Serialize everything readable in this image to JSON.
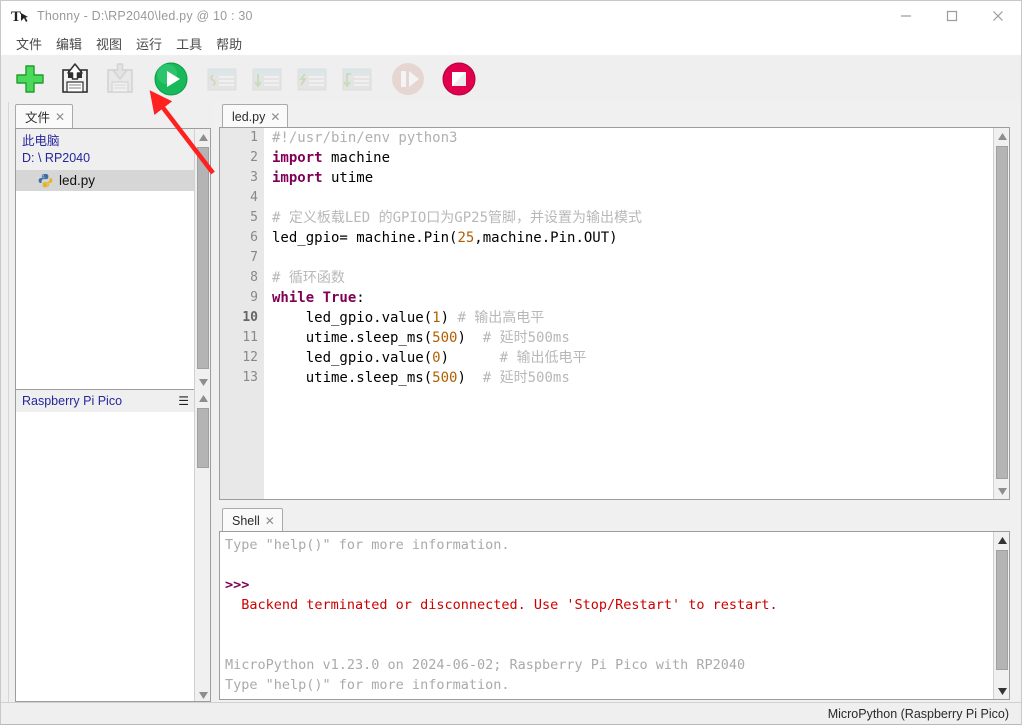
{
  "window": {
    "app_icon": "thonny-icon",
    "title": "Thonny  -  D:\\RP2040\\led.py  @  10 : 30",
    "minimize_label": "–",
    "maximize_label": "□",
    "close_label": "✕"
  },
  "menubar": {
    "items": [
      {
        "label": "文件",
        "name": "menu-file"
      },
      {
        "label": "编辑",
        "name": "menu-edit"
      },
      {
        "label": "视图",
        "name": "menu-view"
      },
      {
        "label": "运行",
        "name": "menu-run"
      },
      {
        "label": "工具",
        "name": "menu-tools"
      },
      {
        "label": "帮助",
        "name": "menu-help"
      }
    ]
  },
  "toolbar": {
    "buttons": [
      {
        "name": "new-file-button",
        "icon": "plus-icon",
        "enabled": true,
        "tooltip": "New"
      },
      {
        "name": "save-button",
        "icon": "save-icon",
        "enabled": true,
        "tooltip": "Save"
      },
      {
        "name": "load-button",
        "icon": "load-icon",
        "enabled": false,
        "tooltip": "Load"
      },
      {
        "name": "run-button",
        "icon": "run-play-icon",
        "enabled": true,
        "tooltip": "Run current script"
      },
      {
        "name": "debug-button",
        "icon": "debug-icon",
        "enabled": false,
        "tooltip": "Debug current script"
      },
      {
        "name": "step-over-button",
        "icon": "step-over-icon",
        "enabled": false,
        "tooltip": "Step over"
      },
      {
        "name": "step-into-button",
        "icon": "step-into-icon",
        "enabled": false,
        "tooltip": "Step into"
      },
      {
        "name": "step-out-button",
        "icon": "step-out-icon",
        "enabled": false,
        "tooltip": "Step out"
      },
      {
        "name": "resume-button",
        "icon": "resume-icon",
        "enabled": false,
        "tooltip": "Resume"
      },
      {
        "name": "stop-button",
        "icon": "stop-icon",
        "enabled": true,
        "tooltip": "Stop/Restart backend"
      }
    ]
  },
  "file_panel": {
    "tab_label": "文件",
    "tab_close": "✕",
    "this_pc_label": "此电脑",
    "path_label": "D: \\ RP2040",
    "files": [
      {
        "name": "led.py",
        "icon": "python-file-icon",
        "selected": true
      }
    ],
    "device_label": "Raspberry Pi Pico",
    "device_menu_icon": "hamburger-icon"
  },
  "editor": {
    "tab_label": "led.py",
    "tab_close": "✕",
    "line_numbers": [
      1,
      2,
      3,
      4,
      5,
      6,
      7,
      8,
      9,
      10,
      11,
      12,
      13
    ],
    "lines": [
      {
        "n": 1,
        "tokens": [
          {
            "t": "#!/usr/bin/env python3",
            "c": "cmt"
          }
        ]
      },
      {
        "n": 2,
        "tokens": [
          {
            "t": "import",
            "c": "kw"
          },
          {
            "t": " machine",
            "c": ""
          }
        ]
      },
      {
        "n": 3,
        "tokens": [
          {
            "t": "import",
            "c": "kw"
          },
          {
            "t": " utime",
            "c": ""
          }
        ]
      },
      {
        "n": 4,
        "tokens": []
      },
      {
        "n": 5,
        "tokens": [
          {
            "t": "# 定义板载LED 的GPIO口为GP25管脚，并设置为输出模式",
            "c": "cmt-cjk"
          }
        ]
      },
      {
        "n": 6,
        "tokens": [
          {
            "t": "led_gpio= machine.Pin(",
            "c": ""
          },
          {
            "t": "25",
            "c": "num"
          },
          {
            "t": ",machine.Pin.OUT)",
            "c": ""
          }
        ]
      },
      {
        "n": 7,
        "tokens": []
      },
      {
        "n": 8,
        "tokens": [
          {
            "t": "# 循环函数",
            "c": "cmt-cjk"
          }
        ]
      },
      {
        "n": 9,
        "tokens": [
          {
            "t": "while True",
            "c": "kw"
          },
          {
            "t": ":",
            "c": ""
          }
        ]
      },
      {
        "n": 10,
        "tokens": [
          {
            "t": "    led_gpio.value(",
            "c": ""
          },
          {
            "t": "1",
            "c": "num"
          },
          {
            "t": ") ",
            "c": ""
          },
          {
            "t": "# 输出高电平",
            "c": "cmt-cjk"
          }
        ]
      },
      {
        "n": 11,
        "tokens": [
          {
            "t": "    utime.sleep_ms(",
            "c": ""
          },
          {
            "t": "500",
            "c": "num"
          },
          {
            "t": ")  ",
            "c": ""
          },
          {
            "t": "# 延时500ms",
            "c": "cmt-cjk"
          }
        ]
      },
      {
        "n": 12,
        "tokens": [
          {
            "t": "    led_gpio.value(",
            "c": ""
          },
          {
            "t": "0",
            "c": "num"
          },
          {
            "t": ")      ",
            "c": ""
          },
          {
            "t": "# 输出低电平",
            "c": "cmt-cjk"
          }
        ]
      },
      {
        "n": 13,
        "tokens": [
          {
            "t": "    utime.sleep_ms(",
            "c": ""
          },
          {
            "t": "500",
            "c": "num"
          },
          {
            "t": ")  ",
            "c": ""
          },
          {
            "t": "# 延时500ms",
            "c": "cmt-cjk"
          }
        ]
      }
    ]
  },
  "shell": {
    "tab_label": "Shell",
    "tab_close": "✕",
    "lines": [
      {
        "text": "Type \"help()\" for more information.",
        "style": "normal"
      },
      {
        "text": "",
        "style": "normal"
      },
      {
        "text": ">>>",
        "style": "prompt"
      },
      {
        "text": "  Backend terminated or disconnected. Use 'Stop/Restart' to restart.",
        "style": "error"
      },
      {
        "text": "",
        "style": "normal"
      },
      {
        "text": "",
        "style": "normal"
      },
      {
        "text": "MicroPython v1.23.0 on 2024-06-02; Raspberry Pi Pico with RP2040",
        "style": "normal"
      },
      {
        "text": "Type \"help()\" for more information.",
        "style": "normal"
      },
      {
        "text": ">>>",
        "style": "prompt"
      }
    ]
  },
  "statusbar": {
    "interpreter": "MicroPython (Raspberry Pi Pico)"
  },
  "annotation": {
    "arrow_color": "#ff2020",
    "arrow_name": "red-pointer-arrow",
    "points_at": "run-button"
  },
  "colors": {
    "run_green": "#17b95a",
    "stop_red": "#e0004d",
    "plus_green": "#44d250",
    "accent_blue": "#26269c",
    "keyword": "#7f0055",
    "number": "#b06000",
    "comment": "#b0b0b0",
    "error_red": "#cc0000"
  }
}
